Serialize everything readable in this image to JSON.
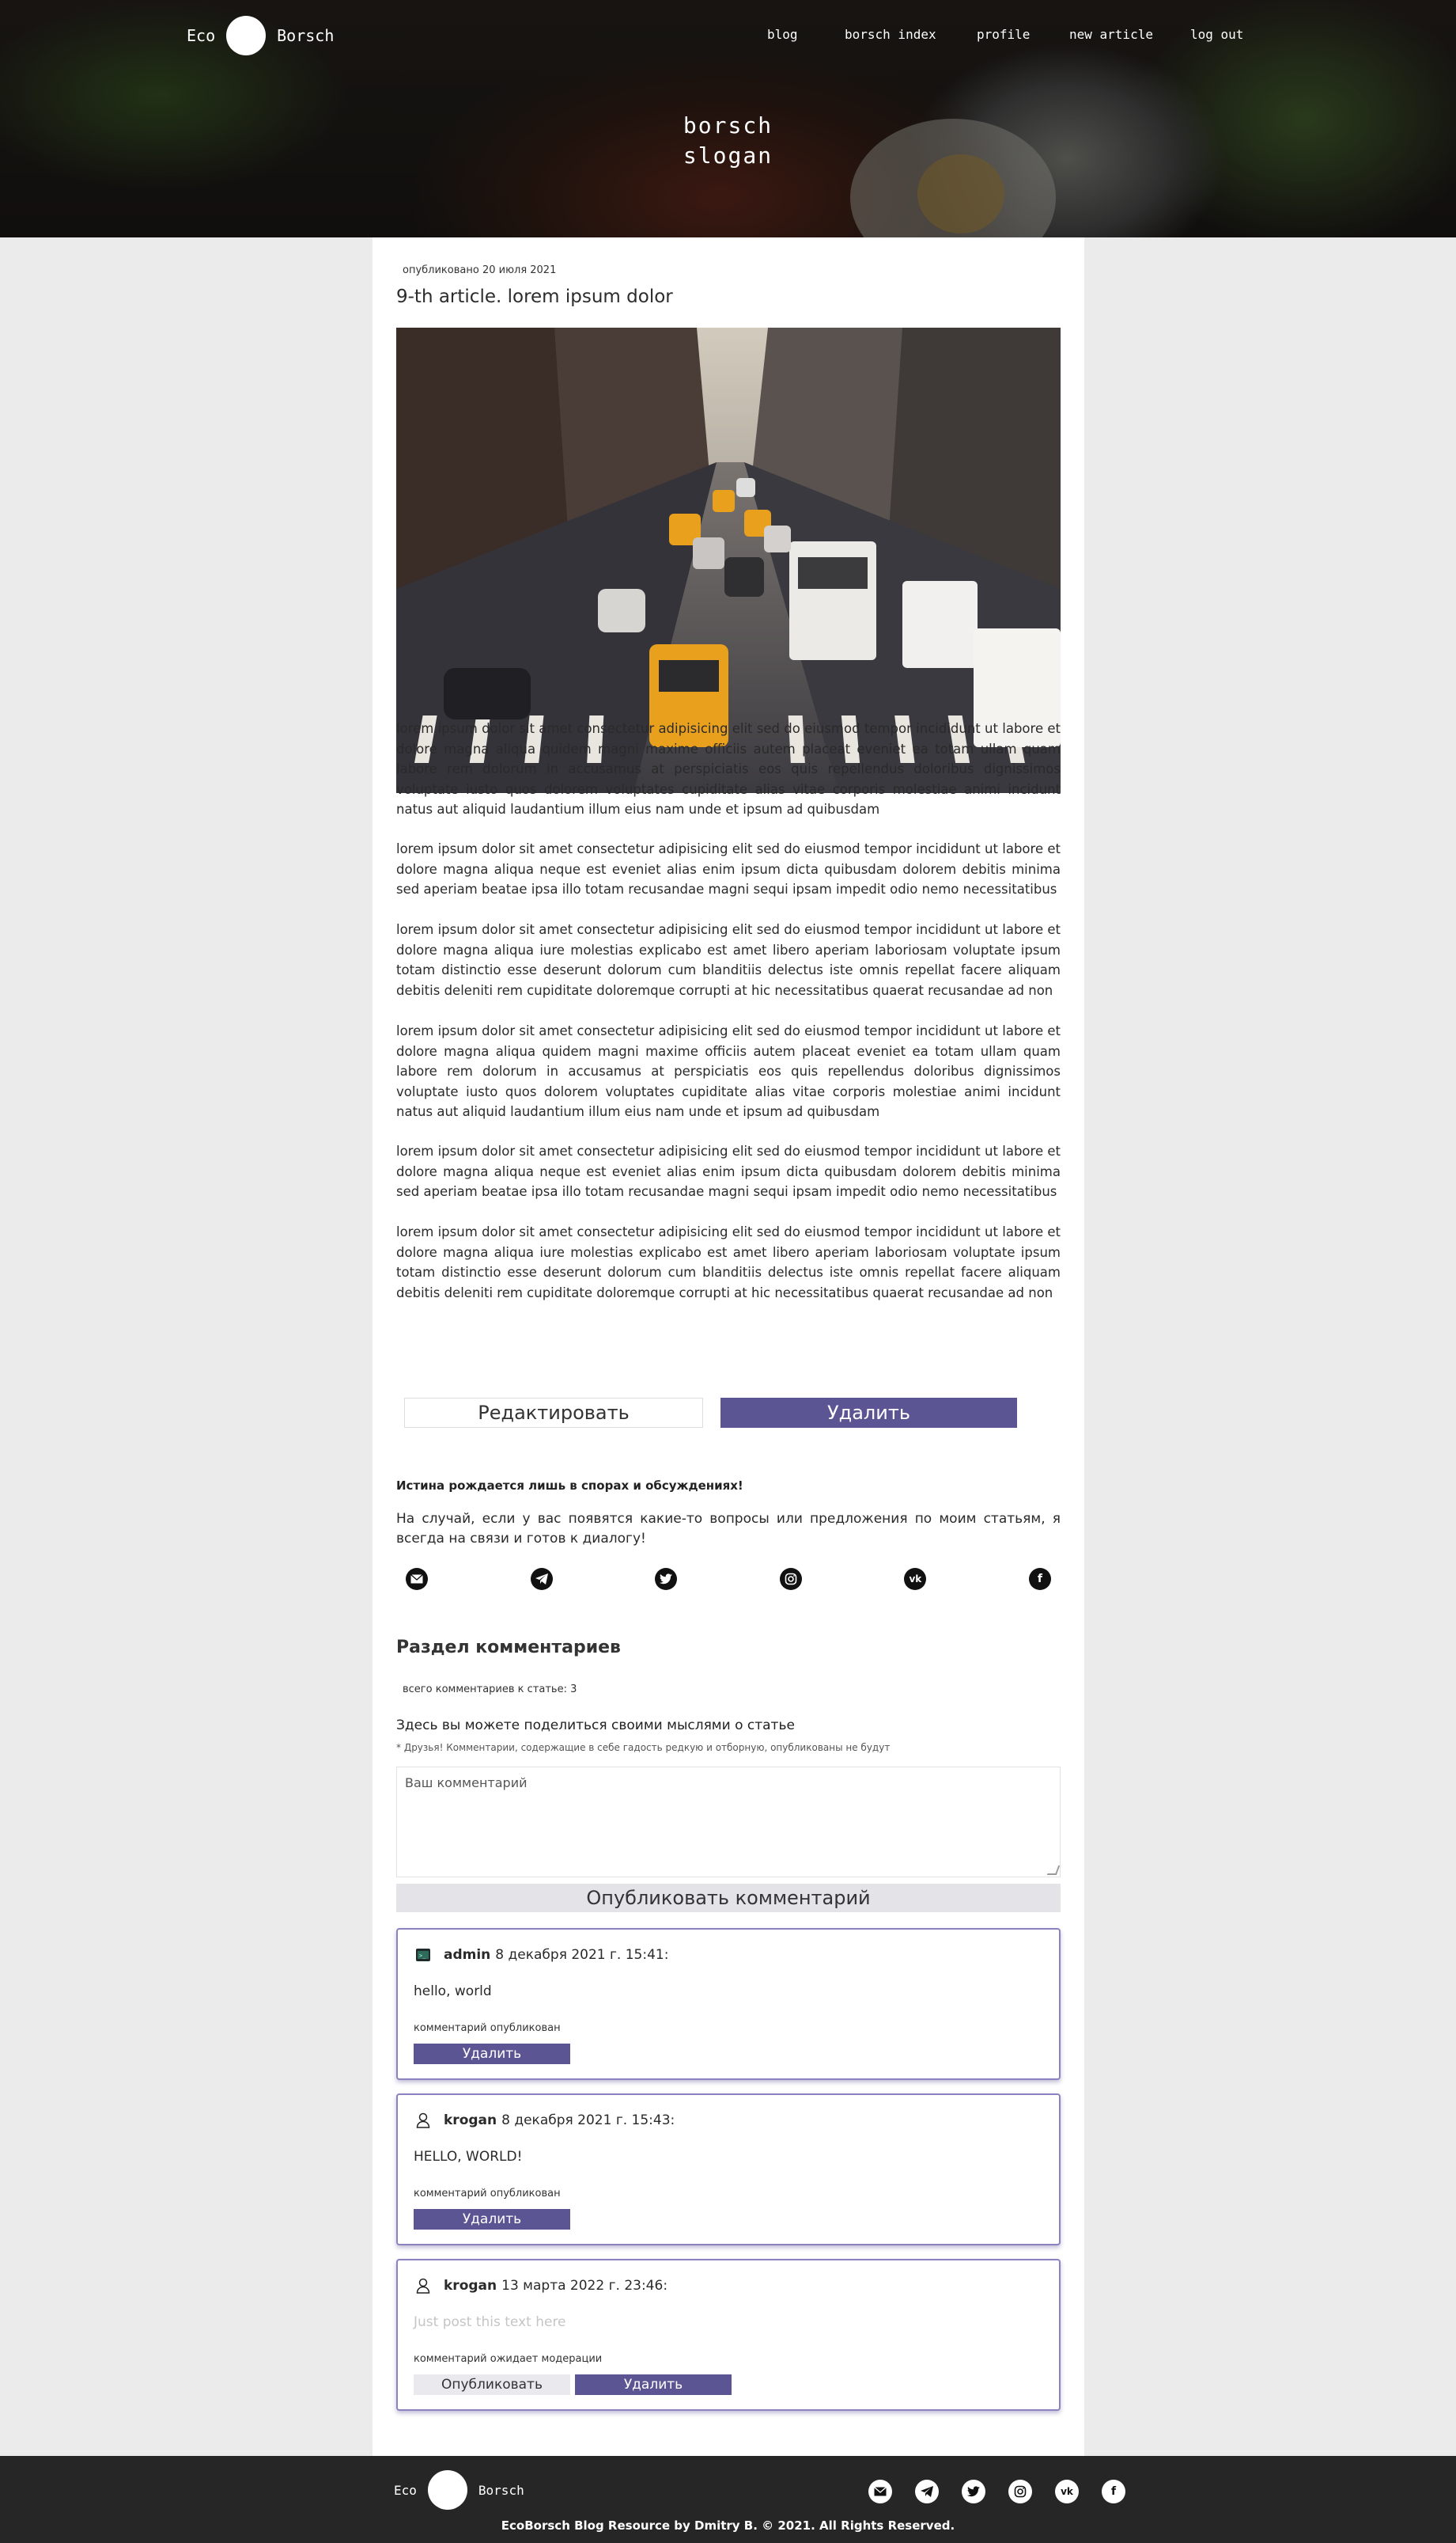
{
  "header": {
    "logo_left": "Eco",
    "logo_right": "Borsch",
    "nav": [
      "blog",
      "borsch index",
      "profile",
      "new article",
      "log out"
    ],
    "slogan_line1": "borsch",
    "slogan_line2": "slogan"
  },
  "article": {
    "published": "опубликовано 20 июля 2021",
    "title": "9-th article. lorem ipsum dolor",
    "paragraphs": [
      "lorem ipsum dolor sit amet consectetur adipisicing elit sed do eiusmod tempor incididunt ut labore et dolore magna aliqua quidem magni maxime officiis autem placeat eveniet ea totam ullam quam labore rem dolorum in accusamus at perspiciatis eos quis repellendus doloribus dignissimos voluptate iusto quos dolorem voluptates cupiditate alias vitae corporis molestiae animi incidunt natus aut aliquid laudantium illum eius nam unde et ipsum ad quibusdam",
      "lorem ipsum dolor sit amet consectetur adipisicing elit sed do eiusmod tempor incididunt ut labore et dolore magna aliqua neque est eveniet alias enim ipsum dicta quibusdam dolorem debitis minima sed aperiam beatae ipsa illo totam recusandae magni sequi ipsam impedit odio nemo necessitatibus",
      "lorem ipsum dolor sit amet consectetur adipisicing elit sed do eiusmod tempor incididunt ut labore et dolore magna aliqua iure molestias explicabo est amet libero aperiam laboriosam voluptate ipsum totam distinctio esse deserunt dolorum cum blanditiis delectus iste omnis repellat facere aliquam debitis deleniti rem cupiditate doloremque corrupti at hic necessitatibus quaerat recusandae ad non",
      "lorem ipsum dolor sit amet consectetur adipisicing elit sed do eiusmod tempor incididunt ut labore et dolore magna aliqua quidem magni maxime officiis autem placeat eveniet ea totam ullam quam labore rem dolorum in accusamus at perspiciatis eos quis repellendus doloribus dignissimos voluptate iusto quos dolorem voluptates cupiditate alias vitae corporis molestiae animi incidunt natus aut aliquid laudantium illum eius nam unde et ipsum ad quibusdam",
      "lorem ipsum dolor sit amet consectetur adipisicing elit sed do eiusmod tempor incididunt ut labore et dolore magna aliqua neque est eveniet alias enim ipsum dicta quibusdam dolorem debitis minima sed aperiam beatae ipsa illo totam recusandae magni sequi ipsam impedit odio nemo necessitatibus",
      "lorem ipsum dolor sit amet consectetur adipisicing elit sed do eiusmod tempor incididunt ut labore et dolore magna aliqua iure molestias explicabo est amet libero aperiam laboriosam voluptate ipsum totam distinctio esse deserunt dolorum cum blanditiis delectus iste omnis repellat facere aliquam debitis deleniti rem cupiditate doloremque corrupti at hic necessitatibus quaerat recusandae ad non"
    ],
    "edit_label": "Редактировать",
    "delete_label": "Удалить"
  },
  "contact": {
    "truth": "Истина рождается лишь в спорах и обсуждениях!",
    "text": "На случай, если у вас появятся какие-то вопросы или предложения по моим статьям, я всегда на связи и готов к диалогу!",
    "socials": [
      "mail-icon",
      "telegram-icon",
      "twitter-icon",
      "instagram-icon",
      "vk-icon",
      "facebook-icon"
    ]
  },
  "comments": {
    "heading": "Раздел комментариев",
    "count": "всего комментариев к статье: 3",
    "share": "Здесь вы можете поделиться своими мыслями о статье",
    "note": "* Друзья! Комментарии, содержащие в себе гадость редкую и отборную, опубликованы не будут",
    "placeholder": "Ваш комментарий",
    "publish_label": "Опубликовать комментарий",
    "items": [
      {
        "author": "admin",
        "date": "8 декабря 2021 г. 15:41:",
        "text": "hello, world",
        "status": "комментарий опубликован",
        "delete": "Удалить",
        "avatar": "terminal-avatar-icon"
      },
      {
        "author": "krogan",
        "date": "8 декабря 2021 г. 15:43:",
        "text": "HELLO, WORLD!",
        "status": "комментарий опубликован",
        "delete": "Удалить",
        "avatar": "user-outline-icon"
      },
      {
        "author": "krogan",
        "date": "13 марта 2022 г. 23:46:",
        "text": "Just post this text here",
        "status": "комментарий ожидает модерации",
        "publish": "Опубликовать",
        "delete": "Удалить",
        "avatar": "user-outline-icon"
      }
    ]
  },
  "footer": {
    "logo_left": "Eco",
    "logo_right": "Borsch",
    "copyright": "EcoBorsch Blog Resource by Dmitry B. © 2021. All Rights Reserved."
  },
  "colors": {
    "accent": "#5c5594",
    "card_border": "#8a83bf",
    "footer": "#262626",
    "page_bg": "#ebebeb"
  }
}
